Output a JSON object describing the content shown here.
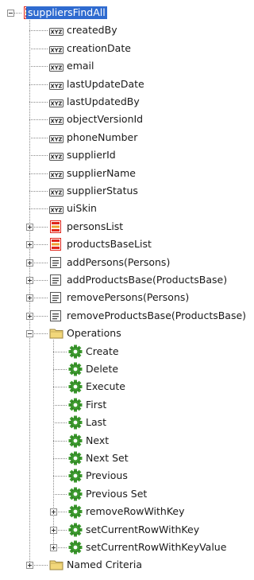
{
  "tree": [
    {
      "label": "suppliersFindAll",
      "icon": "collection",
      "level": 0,
      "toggle": "minus",
      "selected": true
    },
    {
      "label": "createdBy",
      "icon": "attribute",
      "level": 1
    },
    {
      "label": "creationDate",
      "icon": "attribute",
      "level": 1
    },
    {
      "label": "email",
      "icon": "attribute",
      "level": 1
    },
    {
      "label": "lastUpdateDate",
      "icon": "attribute",
      "level": 1
    },
    {
      "label": "lastUpdatedBy",
      "icon": "attribute",
      "level": 1
    },
    {
      "label": "objectVersionId",
      "icon": "attribute",
      "level": 1
    },
    {
      "label": "phoneNumber",
      "icon": "attribute",
      "level": 1
    },
    {
      "label": "supplierId",
      "icon": "attribute",
      "level": 1
    },
    {
      "label": "supplierName",
      "icon": "attribute",
      "level": 1
    },
    {
      "label": "supplierStatus",
      "icon": "attribute",
      "level": 1
    },
    {
      "label": "uiSkin",
      "icon": "attribute",
      "level": 1
    },
    {
      "label": "personsList",
      "icon": "collection",
      "level": 1,
      "toggle": "plus"
    },
    {
      "label": "productsBaseList",
      "icon": "collection",
      "level": 1,
      "toggle": "plus"
    },
    {
      "label": "addPersons(Persons)",
      "icon": "method",
      "level": 1,
      "toggle": "plus"
    },
    {
      "label": "addProductsBase(ProductsBase)",
      "icon": "method",
      "level": 1,
      "toggle": "plus"
    },
    {
      "label": "removePersons(Persons)",
      "icon": "method",
      "level": 1,
      "toggle": "plus"
    },
    {
      "label": "removeProductsBase(ProductsBase)",
      "icon": "method",
      "level": 1,
      "toggle": "plus"
    },
    {
      "label": "Operations",
      "icon": "folder",
      "level": 1,
      "toggle": "minus"
    },
    {
      "label": "Create",
      "icon": "operation",
      "level": 2
    },
    {
      "label": "Delete",
      "icon": "operation",
      "level": 2
    },
    {
      "label": "Execute",
      "icon": "operation",
      "level": 2
    },
    {
      "label": "First",
      "icon": "operation",
      "level": 2
    },
    {
      "label": "Last",
      "icon": "operation",
      "level": 2
    },
    {
      "label": "Next",
      "icon": "operation",
      "level": 2
    },
    {
      "label": "Next Set",
      "icon": "operation",
      "level": 2
    },
    {
      "label": "Previous",
      "icon": "operation",
      "level": 2
    },
    {
      "label": "Previous Set",
      "icon": "operation",
      "level": 2
    },
    {
      "label": "removeRowWithKey",
      "icon": "operation",
      "level": 2,
      "toggle": "plus"
    },
    {
      "label": "setCurrentRowWithKey",
      "icon": "operation",
      "level": 2,
      "toggle": "plus"
    },
    {
      "label": "setCurrentRowWithKeyValue",
      "icon": "operation",
      "level": 2,
      "toggle": "plus"
    },
    {
      "label": "Named Criteria",
      "icon": "folder",
      "level": 1,
      "toggle": "plus"
    }
  ],
  "icon_text": {
    "attribute": "XYZ"
  },
  "colors": {
    "selection": "#2f6bd0",
    "collection_red": "#e0251b",
    "collection_orange": "#f0a030",
    "operation_green": "#3c9a2e",
    "folder_yellow": "#f2d77a"
  }
}
